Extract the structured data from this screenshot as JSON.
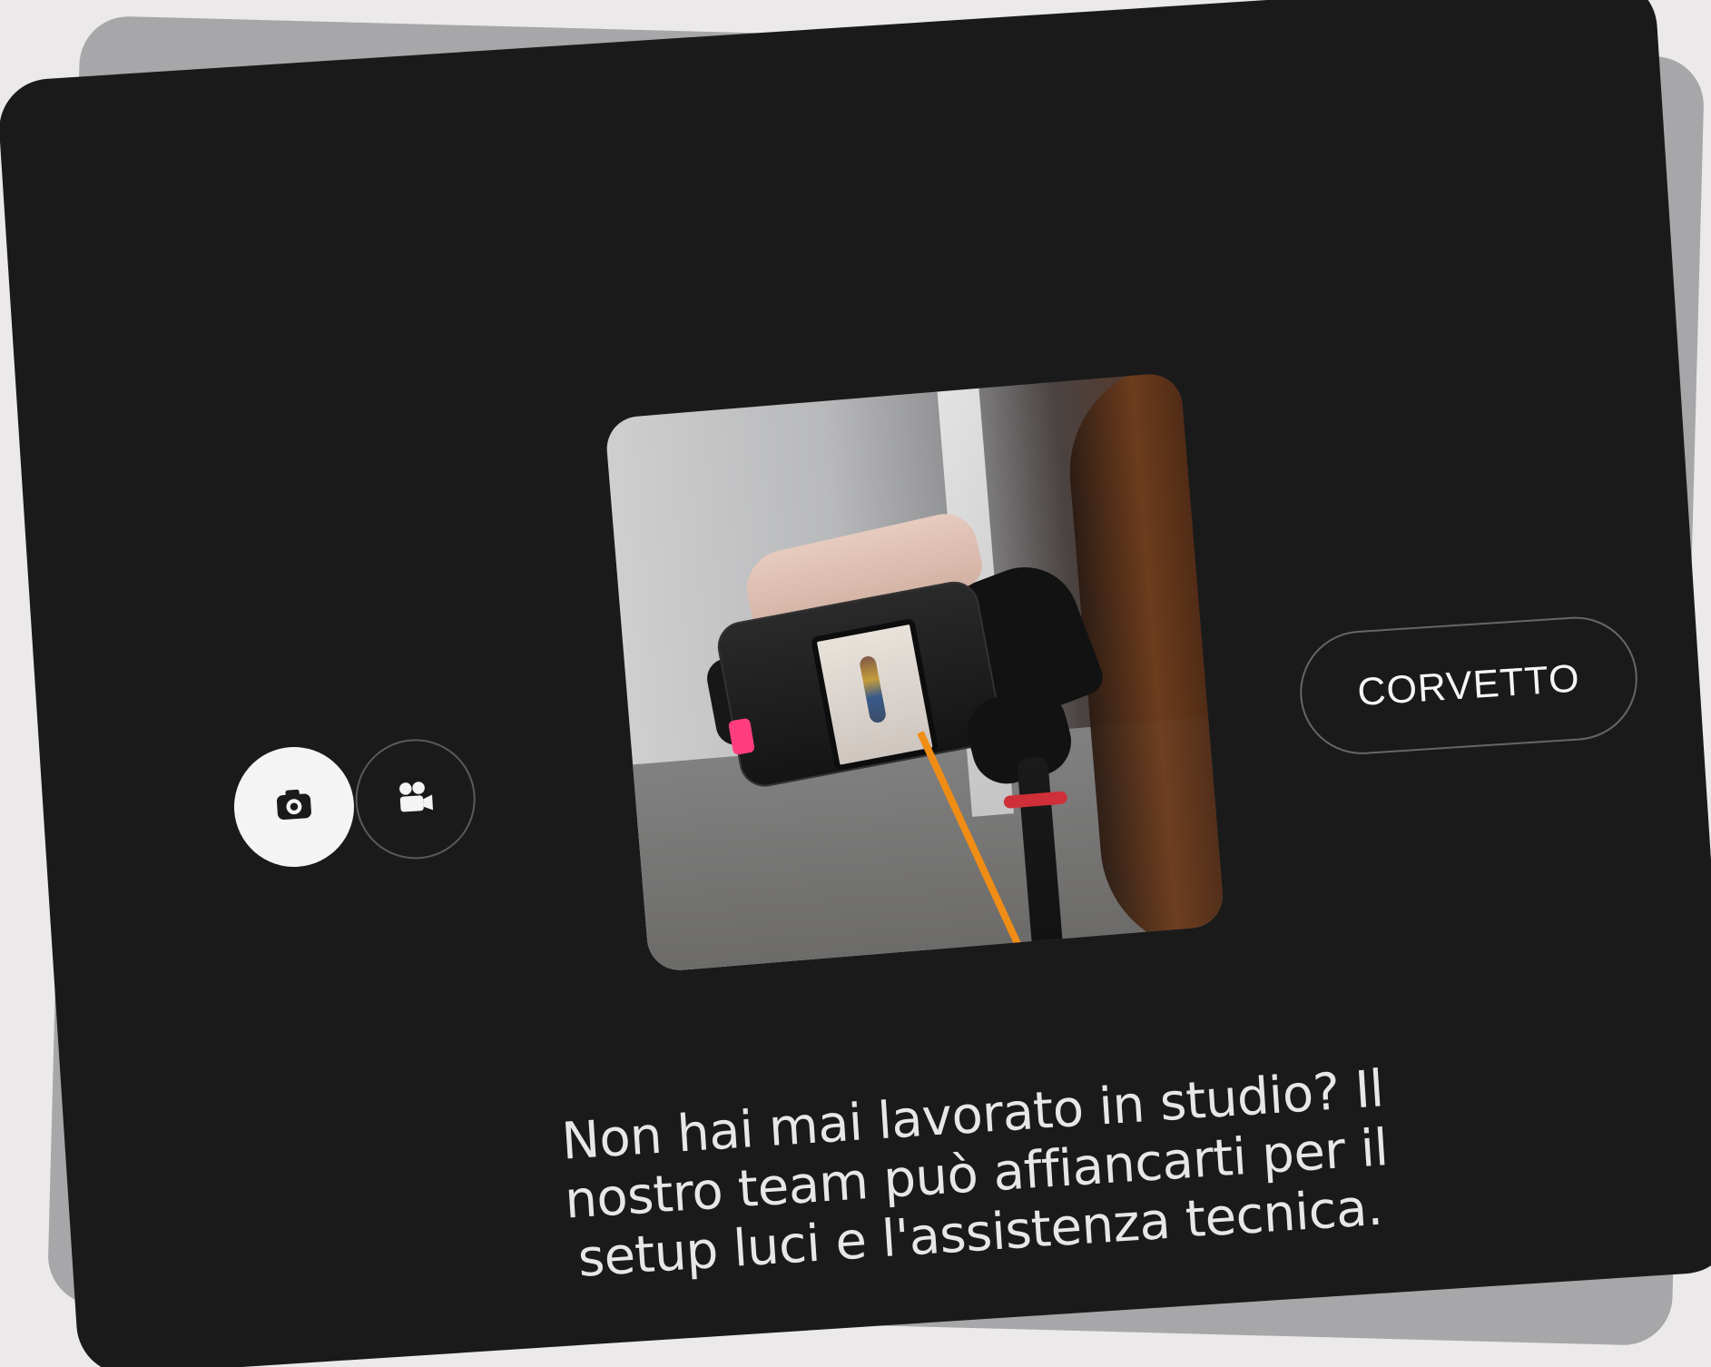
{
  "card": {
    "brand_label": "CORVETTO",
    "description": "Non hai mai lavorato in studio? Il nostro team può affiancarti per il setup luci e l'assistenza tecnica."
  },
  "toggle": {
    "items": [
      {
        "icon": "camera-icon",
        "active": true
      },
      {
        "icon": "video-team-icon",
        "active": false
      }
    ]
  },
  "photo": {
    "subject": "camera-on-tripod-photo"
  },
  "colors": {
    "page_bg": "#ebe9ea",
    "back_card": "#a7a6a8",
    "card_bg": "#1a1a1a",
    "text": "#e7e7e7",
    "accent_white": "#f4f4f4",
    "accent_pink": "#ff3d7f",
    "accent_orange": "#f08d15"
  }
}
